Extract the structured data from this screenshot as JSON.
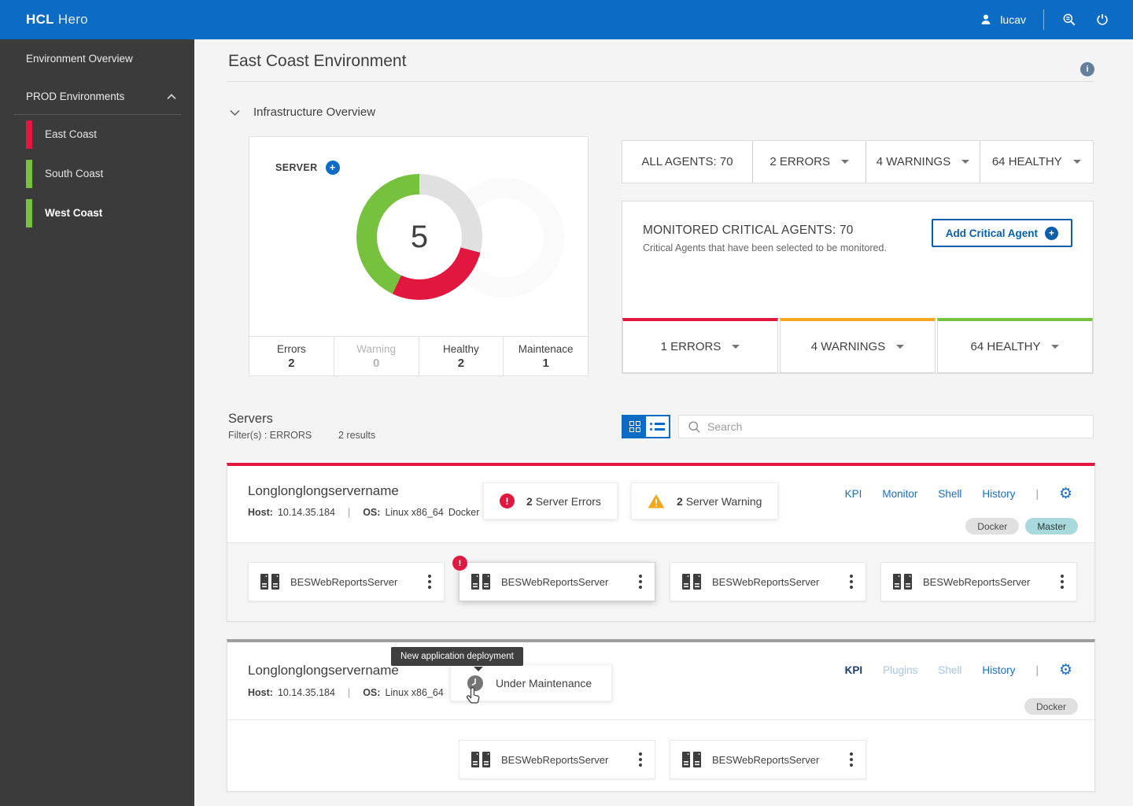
{
  "navbar": {
    "brand_bold": "HCL",
    "brand_light": "Hero",
    "username": "lucav"
  },
  "sidebar": {
    "overview_label": "Environment Overview",
    "group_label": "PROD Environments",
    "items": [
      {
        "label": "East Coast",
        "status_color": "#e1173f",
        "active": false
      },
      {
        "label": "South Coast",
        "status_color": "#76c13d",
        "active": false
      },
      {
        "label": "West Coast",
        "status_color": "#76c13d",
        "active": true
      }
    ]
  },
  "page": {
    "title": "East Coast Environment",
    "section_label": "Infrastructure Overview"
  },
  "chart_data": {
    "type": "donut",
    "title": "SERVER",
    "center_value": "5",
    "total_servers": 5,
    "categories": [
      "Errors",
      "Warning",
      "Healthy",
      "Maintenace"
    ],
    "values": [
      2,
      0,
      2,
      1
    ],
    "segments": [
      {
        "name": "maintenance",
        "color": "#e0e0e0",
        "fraction": 0.29
      },
      {
        "name": "errors",
        "color": "#e1173f",
        "fraction": 0.28
      },
      {
        "name": "healthy",
        "color": "#76c13d",
        "fraction": 0.43
      }
    ],
    "legend": [
      {
        "label": "Errors",
        "value": "2",
        "muted": false
      },
      {
        "label": "Warning",
        "value": "0",
        "muted": true
      },
      {
        "label": "Healthy",
        "value": "2",
        "muted": false
      },
      {
        "label": "Maintenace",
        "value": "1",
        "muted": false
      }
    ]
  },
  "agents_bar": {
    "all_label": "ALL AGENTS: 70",
    "dropdowns": [
      {
        "label": "2 ERRORS"
      },
      {
        "label": "4 WARNINGS"
      },
      {
        "label": "64 HEALTHY"
      }
    ]
  },
  "monitored": {
    "title": "MONITORED CRITICAL AGENTS: 70",
    "subtitle": "Critical Agents that have been selected to be monitored.",
    "add_button": "Add Critical Agent",
    "tiles": [
      {
        "label": "1 ERRORS",
        "color": "#e1173f"
      },
      {
        "label": "4 WARNINGS",
        "color": "#f5a81e"
      },
      {
        "label": "64 HEALTHY",
        "color": "#76c13d"
      }
    ]
  },
  "servers_section": {
    "title": "Servers",
    "filter_text": "Filter(s) : ERRORS",
    "results_text": "2 results",
    "search_placeholder": "Search"
  },
  "server_cards": [
    {
      "name": "Longlonglongservername",
      "host_label": "Host:",
      "host": "10.14.35.184",
      "os_label": "OS:",
      "os": "Linux x86_64",
      "os_tag": "Docker",
      "status_color": "#e1173f",
      "error_chip": {
        "count": "2",
        "label": "Server Errors"
      },
      "warning_chip": {
        "count": "2",
        "label": "Server Warning"
      },
      "links": [
        {
          "label": "KPI"
        },
        {
          "label": "Monitor"
        },
        {
          "label": "Shell"
        },
        {
          "label": "History"
        }
      ],
      "tags": [
        {
          "label": "Docker"
        },
        {
          "label": "Master"
        }
      ],
      "agents": [
        {
          "label": "BESWebReportsServer"
        },
        {
          "label": "BESWebReportsServer",
          "badge": "!"
        },
        {
          "label": "BESWebReportsServer"
        },
        {
          "label": "BESWebReportsServer"
        }
      ]
    },
    {
      "name": "Longlonglongservername",
      "host_label": "Host:",
      "host": "10.14.35.184",
      "os_label": "OS:",
      "os": "Linux x86_64",
      "status_color": "#9e9e9e",
      "maintenance": {
        "label": "Under Maintenance",
        "tooltip": "New application deployment"
      },
      "links": [
        {
          "label": "KPI",
          "state": "dark"
        },
        {
          "label": "Plugins",
          "state": "disabled"
        },
        {
          "label": "Shell",
          "state": "disabled"
        },
        {
          "label": "History",
          "state": "normal"
        }
      ],
      "tags": [
        {
          "label": "Docker"
        }
      ],
      "agents": [
        {
          "label": "BESWebReportsServer"
        },
        {
          "label": "BESWebReportsServer"
        }
      ]
    }
  ],
  "icons": {
    "exclamation": "!",
    "info": "i",
    "plus": "+",
    "gear": "⚙",
    "pipe": "|"
  },
  "colors": {
    "brand_blue": "#0c6cc4",
    "link_blue": "#1a6fc4",
    "error_red": "#e1173f",
    "warning_amber": "#f5a81e",
    "healthy_green": "#76c13d",
    "master_teal": "#a7d9dd",
    "sidebar_gray": "#3b3b3b"
  }
}
